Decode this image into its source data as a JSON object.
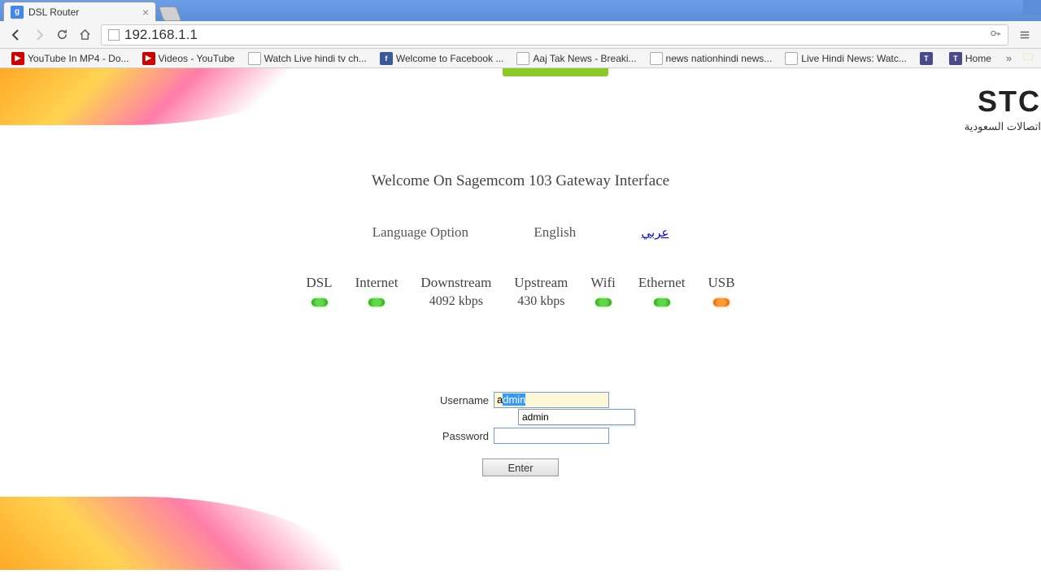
{
  "browser": {
    "tab_title": "DSL Router",
    "url": "192.168.1.1",
    "bookmarks": [
      {
        "label": "YouTube In MP4 - Do...",
        "icon": "yt"
      },
      {
        "label": "Videos - YouTube",
        "icon": "yt"
      },
      {
        "label": "Watch Live hindi tv ch...",
        "icon": "doc"
      },
      {
        "label": "Welcome to Facebook ...",
        "icon": "fb"
      },
      {
        "label": "Aaj Tak News - Breaki...",
        "icon": "doc"
      },
      {
        "label": "news nationhindi news...",
        "icon": "doc"
      },
      {
        "label": "Live Hindi News: Watc...",
        "icon": "doc"
      },
      {
        "label": "",
        "icon": "box"
      },
      {
        "label": "Home",
        "icon": "box"
      }
    ]
  },
  "page": {
    "logo_main": "STC",
    "logo_sub": "اتصالات السعودية",
    "welcome": "Welcome On Sagemcom 103 Gateway Interface",
    "language_label": "Language Option",
    "lang_english": "English",
    "lang_arabic": "عربي",
    "status": [
      {
        "label": "DSL",
        "value": "",
        "led": "green"
      },
      {
        "label": "Internet",
        "value": "",
        "led": "green"
      },
      {
        "label": "Downstream",
        "value": "4092 kbps",
        "led": ""
      },
      {
        "label": "Upstream",
        "value": "430 kbps",
        "led": ""
      },
      {
        "label": "Wifi",
        "value": "",
        "led": "green"
      },
      {
        "label": "Ethernet",
        "value": "",
        "led": "green"
      },
      {
        "label": "USB",
        "value": "",
        "led": "orange"
      }
    ],
    "form": {
      "username_label": "Username",
      "password_label": "Password",
      "username_value": "admin",
      "autocomplete_value": "admin",
      "enter_label": "Enter"
    }
  }
}
